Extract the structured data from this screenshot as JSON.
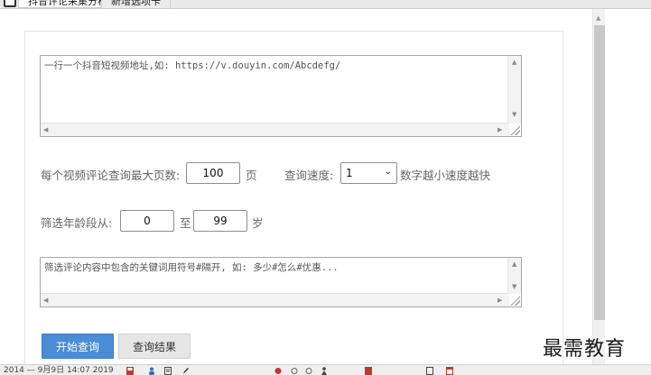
{
  "tabs": [
    {
      "label": "抖音评论采集分析"
    },
    {
      "label": "新增选项卡"
    }
  ],
  "form": {
    "url_textarea": {
      "placeholder": "一行一个抖音短视频地址,如: https://v.douyin.com/Abcdefg/"
    },
    "max_pages": {
      "label": "每个视频评论查询最大页数:",
      "value": "100",
      "unit": "页"
    },
    "speed": {
      "label": "查询速度:",
      "value": "1",
      "hint": "数字越小速度越快"
    },
    "age": {
      "label": "筛选年龄段从:",
      "from": "0",
      "sep": "至",
      "to": "99",
      "unit": "岁"
    },
    "keyword_textarea": {
      "placeholder": "筛选评论内容中包含的关键词用符号#隔开, 如: 多少#怎么#优惠..."
    },
    "start_button": "开始查询",
    "results_button": "查询结果"
  },
  "watermark": "最需教育",
  "statusbar": {
    "text": "2014 — 9月9日 14:07 2019"
  },
  "icons": [
    "app-window-icon",
    "chevron-down-icon",
    "scroll-up-arrow-icon",
    "scroll-down-arrow-icon",
    "resize-grip-icon"
  ]
}
